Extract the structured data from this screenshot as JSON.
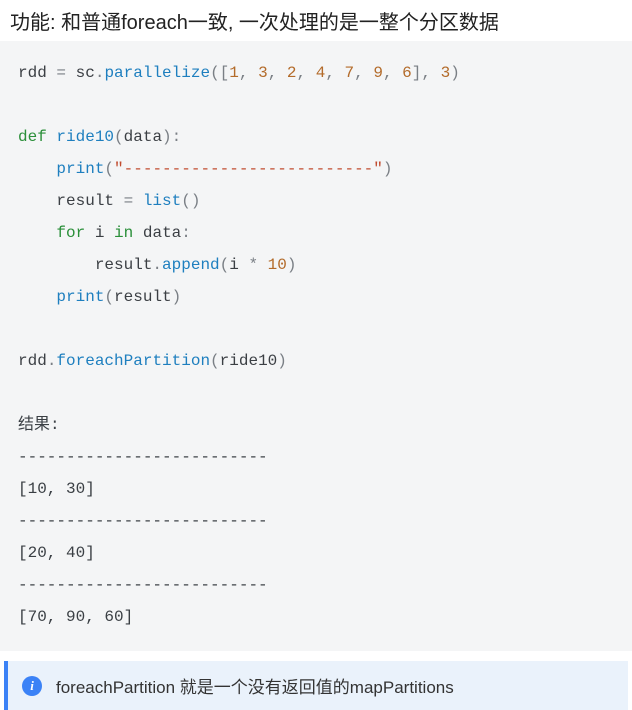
{
  "heading": "功能: 和普通foreach一致, 一次处理的是一整个分区数据",
  "code": {
    "l1": {
      "rdd": "rdd",
      "eq": " = ",
      "sc": "sc",
      "dot1": ".",
      "parallelize": "parallelize",
      "lp": "(",
      "lb": "[",
      "n1": "1",
      "c1": ", ",
      "n2": "3",
      "c2": ", ",
      "n3": "2",
      "c3": ", ",
      "n4": "4",
      "c4": ", ",
      "n5": "7",
      "c5": ", ",
      "n6": "9",
      "c6": ", ",
      "n7": "6",
      "rb": "]",
      "c7": ", ",
      "np": "3",
      "rp": ")"
    },
    "l2": {
      "def": "def",
      "sp": " ",
      "name": "ride10",
      "lp": "(",
      "arg": "data",
      "rp": ")",
      "colon": ":"
    },
    "l3": {
      "indent": "    ",
      "print": "print",
      "lp": "(",
      "str": "\"--------------------------\"",
      "rp": ")"
    },
    "l4": {
      "indent": "    ",
      "result": "result",
      "eq": " = ",
      "list": "list",
      "lp": "(",
      "rp": ")"
    },
    "l5": {
      "indent": "    ",
      "for": "for",
      "sp1": " ",
      "i": "i",
      "sp2": " ",
      "in": "in",
      "sp3": " ",
      "data": "data",
      "colon": ":"
    },
    "l6": {
      "indent": "        ",
      "result": "result",
      "dot": ".",
      "append": "append",
      "lp": "(",
      "i": "i",
      "mul": " * ",
      "ten": "10",
      "rp": ")"
    },
    "l7": {
      "indent": "    ",
      "print": "print",
      "lp": "(",
      "result": "result",
      "rp": ")"
    },
    "l8": {
      "rdd": "rdd",
      "dot": ".",
      "fp": "foreachPartition",
      "lp": "(",
      "arg": "ride10",
      "rp": ")"
    },
    "l9": "结果:",
    "sep": "--------------------------",
    "r1": "[10, 30]",
    "r2": "[20, 40]",
    "r3": "[70, 90, 60]"
  },
  "note": {
    "icon_glyph": "i",
    "text": "foreachPartition 就是一个没有返回值的mapPartitions"
  }
}
